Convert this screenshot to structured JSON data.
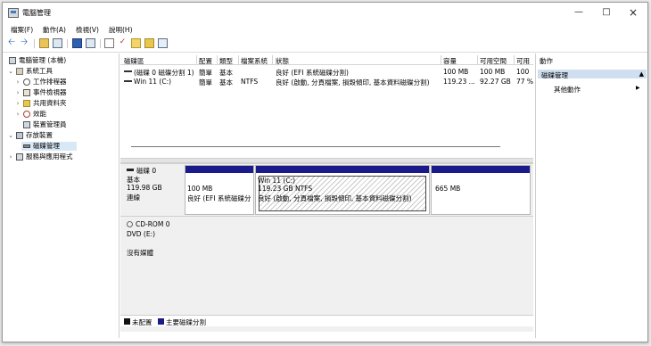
{
  "window": {
    "title": "電腦管理"
  },
  "menu": [
    "檔案(F)",
    "動作(A)",
    "檢視(V)",
    "說明(H)"
  ],
  "tree": [
    {
      "label": "電腦管理 (本機)",
      "icon": "computer-icon"
    },
    {
      "label": "系統工具",
      "icon": "tools-icon"
    },
    {
      "label": "工作排程器",
      "icon": "clock-icon"
    },
    {
      "label": "事件檢視器",
      "icon": "event-icon"
    },
    {
      "label": "共用資料夾",
      "icon": "folder-icon"
    },
    {
      "label": "效能",
      "icon": "performance-icon"
    },
    {
      "label": "裝置管理員",
      "icon": "device-icon"
    },
    {
      "label": "存放裝置",
      "icon": "storage-icon"
    },
    {
      "label": "磁碟管理",
      "icon": "disk-icon"
    },
    {
      "label": "服務與應用程式",
      "icon": "services-icon"
    }
  ],
  "volumes": {
    "columns": [
      "磁碟區",
      "配置",
      "類型",
      "檔案系統",
      "狀態",
      "容量",
      "可用空間",
      "可用"
    ],
    "rows": [
      [
        "(磁碟 0 磁碟分割 1)",
        "簡單",
        "基本",
        "",
        "良好 (EFI 系統磁碟分割)",
        "100 MB",
        "100 MB",
        "100"
      ],
      [
        "Win 11 (C:)",
        "簡單",
        "基本",
        "NTFS",
        "良好 (啟動, 分頁檔案, 損毀傾印, 基本資料磁碟分割)",
        "119.23 ...",
        "92.27 GB",
        "77 %"
      ]
    ]
  },
  "disks": {
    "disk0": {
      "name": "磁碟 0",
      "type": "基本",
      "size": "119.98 GB",
      "status": "連線",
      "partitions": [
        {
          "title": "",
          "size": "100 MB",
          "status": "良好 (EFI 系統磁碟分割)"
        },
        {
          "title": "Win 11  (C:)",
          "size": "119.23 GB NTFS",
          "status": "良好 (啟動, 分頁檔案, 損毀傾印, 基本資料磁碟分割)"
        },
        {
          "title": "",
          "size": "665 MB",
          "status": ""
        }
      ]
    },
    "cdrom": {
      "name": "CD-ROM 0",
      "drive": "DVD (E:)",
      "media": "沒有媒體"
    }
  },
  "legend": [
    {
      "label": "未配置",
      "color": "#111111"
    },
    {
      "label": "主要磁碟分割",
      "color": "#1a1a8a"
    }
  ],
  "actions": {
    "header": "動作",
    "section": "磁碟管理",
    "more": "其他動作"
  }
}
